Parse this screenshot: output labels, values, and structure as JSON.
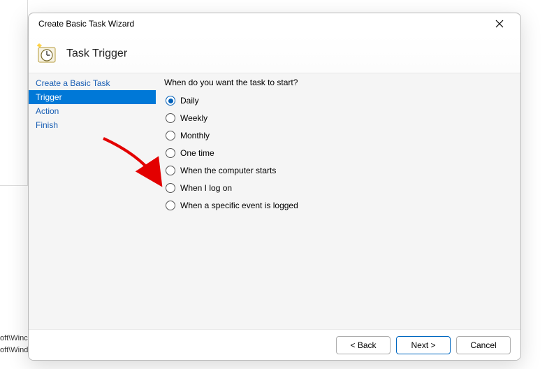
{
  "bg": {
    "line1": "oft\\Winc",
    "line2": "oft\\Windows\\O..."
  },
  "dialog": {
    "title": "Create Basic Task Wizard",
    "headerTitle": "Task Trigger",
    "steps": [
      "Create a Basic Task",
      "Trigger",
      "Action",
      "Finish"
    ],
    "activeStepIndex": 1,
    "prompt": "When do you want the task to start?",
    "options": [
      "Daily",
      "Weekly",
      "Monthly",
      "One time",
      "When the computer starts",
      "When I log on",
      "When a specific event is logged"
    ],
    "selectedOptionIndex": 0,
    "buttons": {
      "back": "< Back",
      "next": "Next >",
      "cancel": "Cancel"
    }
  }
}
